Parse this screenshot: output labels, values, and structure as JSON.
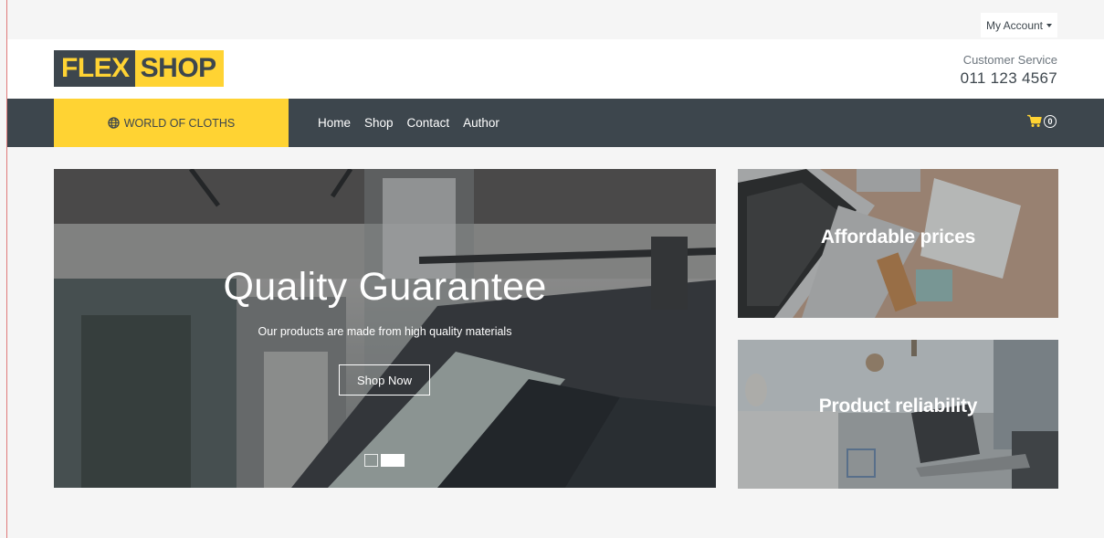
{
  "topbar": {
    "account_label": "My Account"
  },
  "header": {
    "logo_part1": "FLEX",
    "logo_part2": "SHOP",
    "service_label": "Customer Service",
    "service_phone": "011 123 4567"
  },
  "nav": {
    "category_label": "WORLD OF CLOTHS",
    "links": [
      {
        "label": "Home"
      },
      {
        "label": "Shop"
      },
      {
        "label": "Contact"
      },
      {
        "label": "Author"
      }
    ],
    "cart_count": "0"
  },
  "carousel": {
    "title": "Quality Guarantee",
    "subtitle": "Our products are made from high quality materials",
    "button_label": "Shop Now",
    "slide_count": 2,
    "active_slide": 2
  },
  "offers": [
    {
      "title": "Affordable prices"
    },
    {
      "title": "Product reliability"
    }
  ],
  "colors": {
    "accent": "#ffd333",
    "dark": "#3d464d",
    "background": "#f5f5f5"
  },
  "icons": {
    "category": "globe-icon",
    "account_caret": "caret-down-icon",
    "cart": "shopping-cart-icon"
  }
}
